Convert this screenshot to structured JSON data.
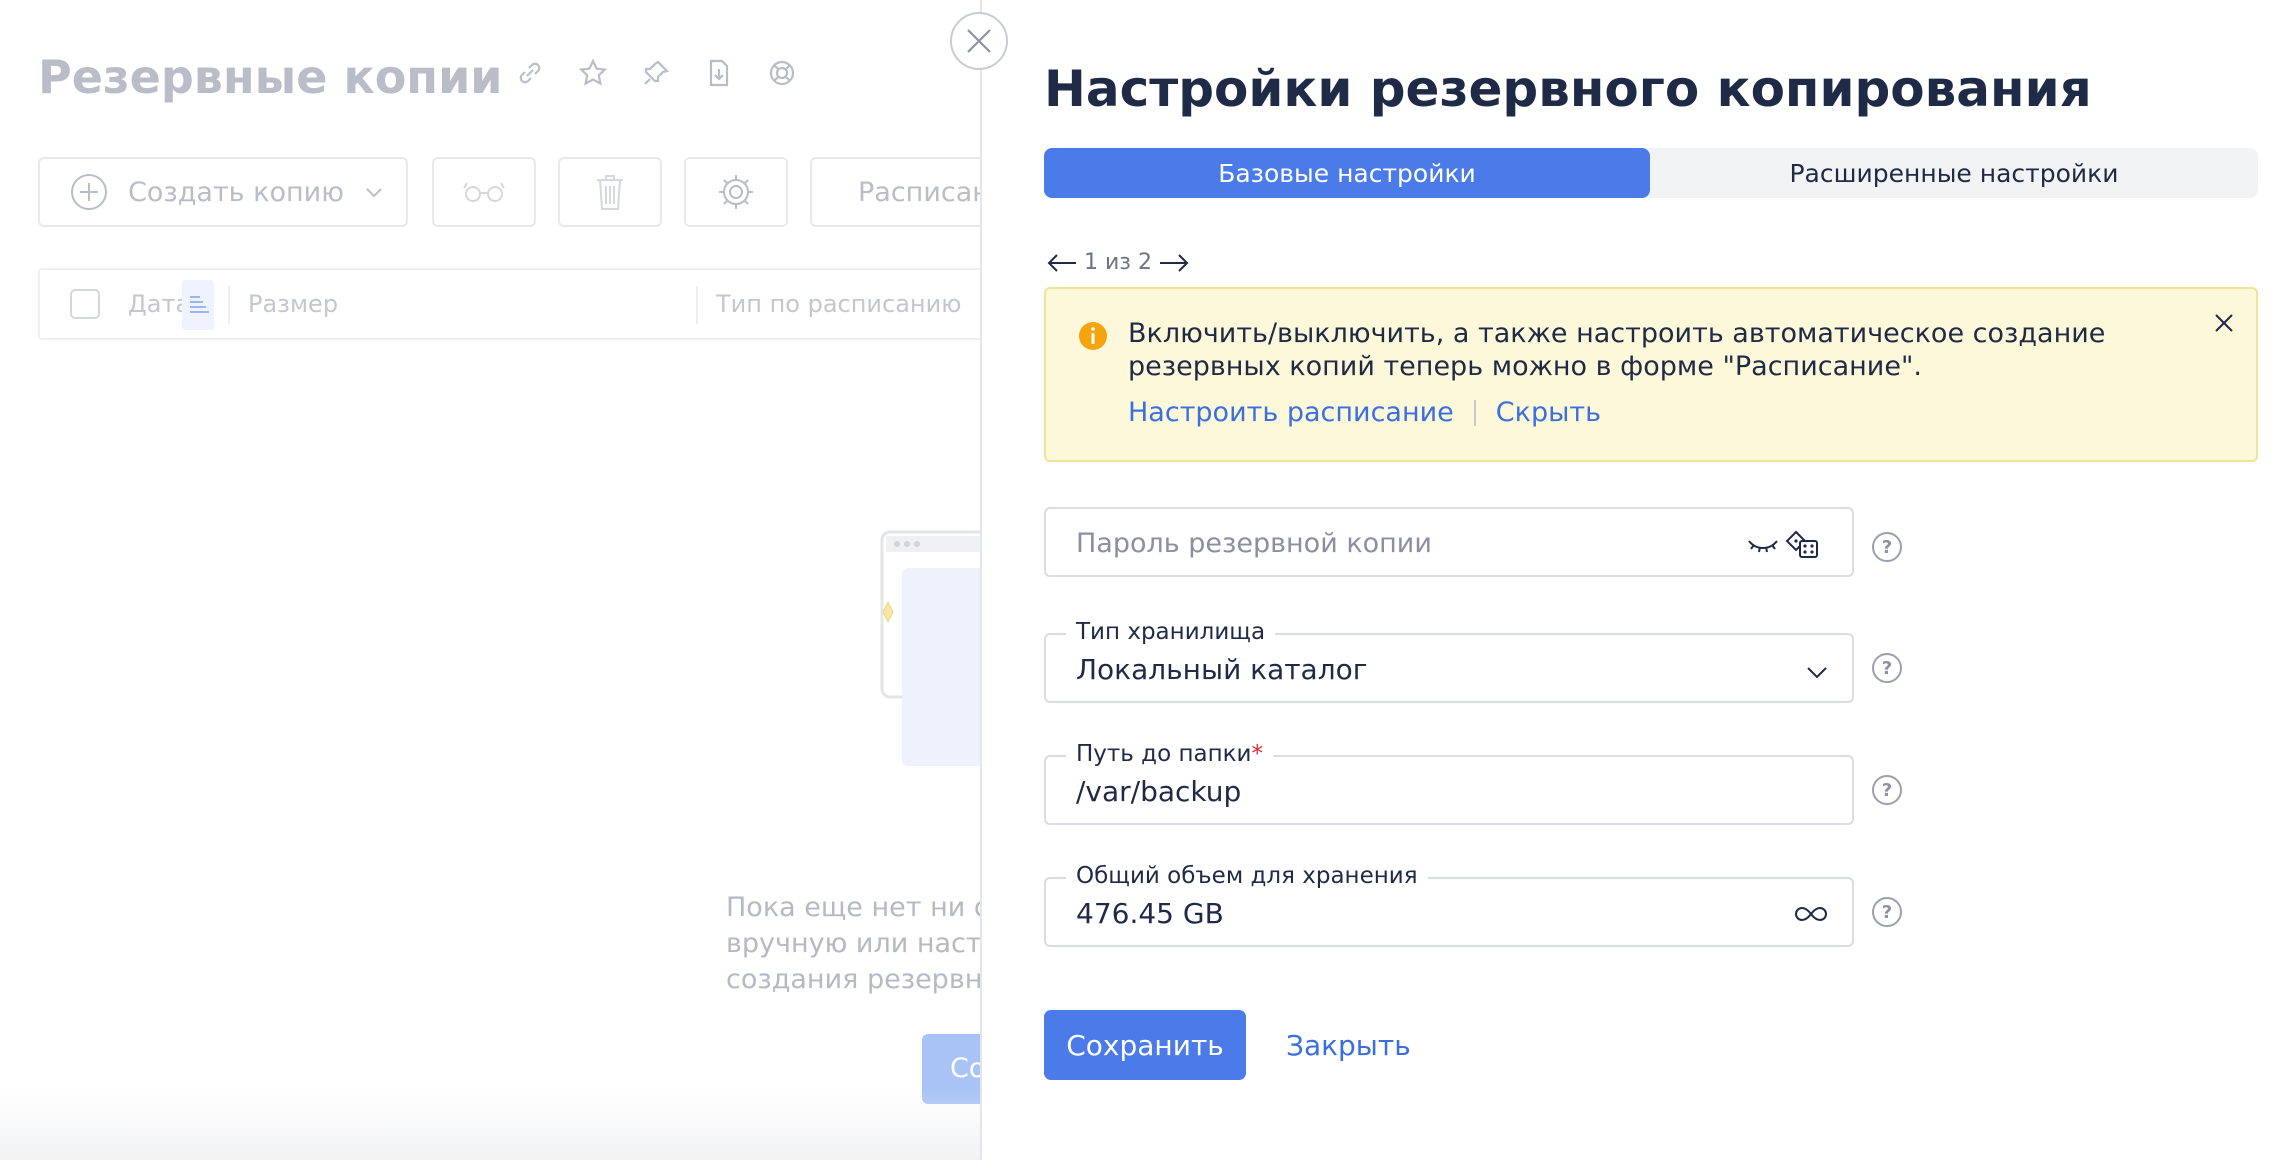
{
  "background": {
    "page_title": "Резервные копии",
    "toolbar": {
      "create_label": "Создать копию",
      "schedule_label": "Расписание"
    },
    "table": {
      "columns": [
        "Дата",
        "Размер",
        "Тип по расписанию"
      ]
    },
    "empty_state": {
      "lines": [
        "Пока еще нет ни од",
        "вручную или настр",
        "создания резервны"
      ],
      "button_label": "Со"
    }
  },
  "panel": {
    "title": "Настройки резервного копирования",
    "tabs": [
      {
        "label": "Базовые настройки",
        "active": true
      },
      {
        "label": "Расширенные настройки",
        "active": false
      }
    ],
    "pager": {
      "text": "1 из 2"
    },
    "notice": {
      "text": "Включить/выключить, а также настроить автоматическое создание резервных копий теперь можно в форме \"Расписание\".",
      "link_schedule": "Настроить расписание",
      "link_hide": "Скрыть"
    },
    "fields": {
      "password": {
        "placeholder": "Пароль резервной копии"
      },
      "storage_type": {
        "label": "Тип хранилища",
        "value": "Локальный каталог"
      },
      "folder_path": {
        "label": "Путь до папки",
        "required_mark": "*",
        "value": "/var/backup"
      },
      "total_volume": {
        "label": "Общий объем для хранения",
        "value": "476.45 GB"
      }
    },
    "buttons": {
      "save": "Сохранить",
      "close": "Закрыть"
    }
  },
  "colors": {
    "accent": "#4a7be9",
    "link": "#3b6fe0",
    "notice_bg": "#fdf8d9",
    "warning_icon": "#f4a40c"
  }
}
